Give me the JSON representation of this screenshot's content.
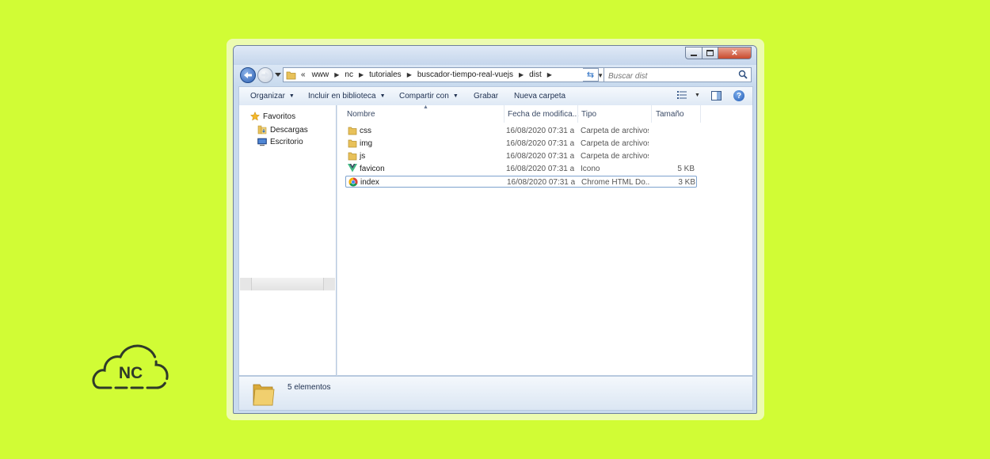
{
  "window": {
    "caption_buttons": {
      "minimize": "minimize-icon",
      "maximize": "maximize-icon",
      "close": "close-icon"
    }
  },
  "navigation": {
    "back_icon": "back-arrow-icon",
    "forward_icon": "forward-arrow-icon",
    "address": {
      "overflow_chevron": "«",
      "crumbs": [
        "www",
        "nc",
        "tutoriales",
        "buscador-tiempo-real-vuejs",
        "dist"
      ]
    },
    "search_placeholder": "Buscar dist"
  },
  "toolbar": {
    "organize": "Organizar",
    "include_library": "Incluir en biblioteca",
    "share_with": "Compartir con",
    "burn": "Grabar",
    "new_folder": "Nueva carpeta"
  },
  "sidebar": {
    "favorites_label": "Favoritos",
    "items": [
      {
        "label": "Descargas",
        "icon": "downloads-folder-icon"
      },
      {
        "label": "Escritorio",
        "icon": "desktop-icon"
      }
    ]
  },
  "columns": {
    "name": "Nombre",
    "date": "Fecha de modifica...",
    "type": "Tipo",
    "size": "Tamaño"
  },
  "files": [
    {
      "name": "css",
      "date": "16/08/2020 07:31 a...",
      "type": "Carpeta de archivos",
      "size": "",
      "icon": "folder-icon"
    },
    {
      "name": "img",
      "date": "16/08/2020 07:31 a...",
      "type": "Carpeta de archivos",
      "size": "",
      "icon": "folder-icon"
    },
    {
      "name": "js",
      "date": "16/08/2020 07:31 a...",
      "type": "Carpeta de archivos",
      "size": "",
      "icon": "folder-icon"
    },
    {
      "name": "favicon",
      "date": "16/08/2020 07:31 a...",
      "type": "Icono",
      "size": "5 KB",
      "icon": "vue-logo-icon"
    },
    {
      "name": "index",
      "date": "16/08/2020 07:31 a...",
      "type": "Chrome HTML Do...",
      "size": "3 KB",
      "icon": "chrome-icon"
    }
  ],
  "status": {
    "count_text": "5 elementos"
  },
  "brand": {
    "logo_text": "NC",
    "background": "#d1fc35",
    "accent": "#2a6fc4"
  }
}
